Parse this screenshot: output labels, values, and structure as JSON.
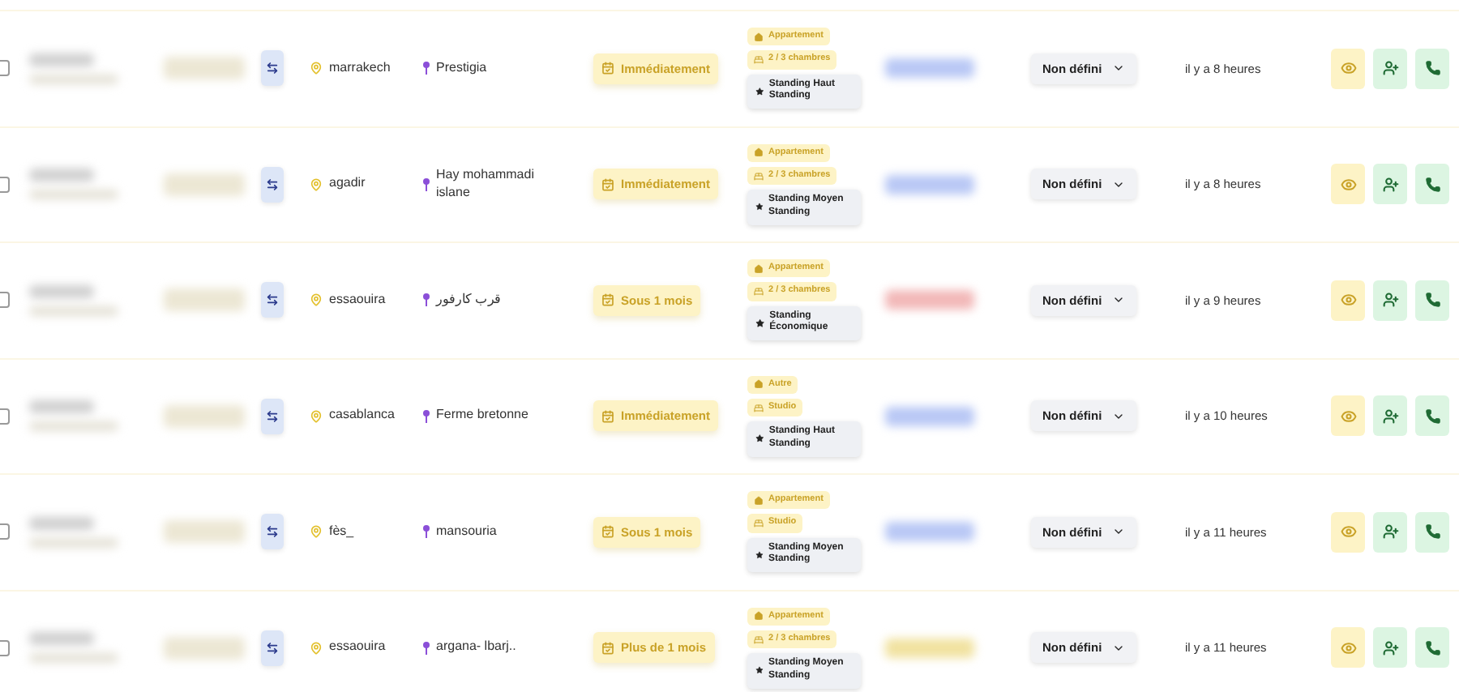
{
  "rows": [
    {
      "checked": false,
      "color": "#b9c8f5",
      "city": "marrakech",
      "district": "Prestigia",
      "timing": "Immédiatement",
      "tags": [
        {
          "kind": "type",
          "label": "Appartement"
        },
        {
          "kind": "rooms",
          "label": "2 / 3 chambres"
        },
        {
          "kind": "standing",
          "label": "Standing Haut Standing"
        }
      ],
      "status": "Non défini",
      "time": "il y a 8 heures"
    },
    {
      "checked": false,
      "color": "#b9c8f5",
      "city": "agadir",
      "district": "Hay mohammadi islane",
      "timing": "Immédiatement",
      "tags": [
        {
          "kind": "type",
          "label": "Appartement"
        },
        {
          "kind": "rooms",
          "label": "2 / 3 chambres"
        },
        {
          "kind": "standing",
          "label": "Standing Moyen Standing"
        }
      ],
      "status": "Non défini",
      "time": "il y a 8 heures"
    },
    {
      "checked": false,
      "color": "#f2b8b8",
      "city": "essaouira",
      "district": "قرب كارفور",
      "timing": "Sous 1 mois",
      "tags": [
        {
          "kind": "type",
          "label": "Appartement"
        },
        {
          "kind": "rooms",
          "label": "2 / 3 chambres"
        },
        {
          "kind": "standing",
          "label": "Standing Économique"
        }
      ],
      "status": "Non défini",
      "time": "il y a 9 heures"
    },
    {
      "checked": false,
      "color": "#b9c8f5",
      "city": "casablanca",
      "district": "Ferme bretonne",
      "timing": "Immédiatement",
      "tags": [
        {
          "kind": "type",
          "label": "Autre"
        },
        {
          "kind": "rooms",
          "label": "Studio"
        },
        {
          "kind": "standing",
          "label": "Standing Haut Standing"
        }
      ],
      "status": "Non défini",
      "time": "il y a 10 heures"
    },
    {
      "checked": false,
      "color": "#b9c8f5",
      "city": "fès_",
      "district": "mansouria",
      "timing": "Sous 1 mois",
      "tags": [
        {
          "kind": "type",
          "label": "Appartement"
        },
        {
          "kind": "rooms",
          "label": "Studio"
        },
        {
          "kind": "standing",
          "label": "Standing Moyen Standing"
        }
      ],
      "status": "Non défini",
      "time": "il y a 11 heures"
    },
    {
      "checked": false,
      "color": "#f1e2a0",
      "city": "essaouira",
      "district": "argana- lbarj..",
      "timing": "Plus de 1 mois",
      "tags": [
        {
          "kind": "type",
          "label": "Appartement"
        },
        {
          "kind": "rooms",
          "label": "2 / 3 chambres"
        },
        {
          "kind": "standing",
          "label": "Standing Moyen Standing"
        }
      ],
      "status": "Non défini",
      "time": "il y a 11 heures"
    }
  ]
}
